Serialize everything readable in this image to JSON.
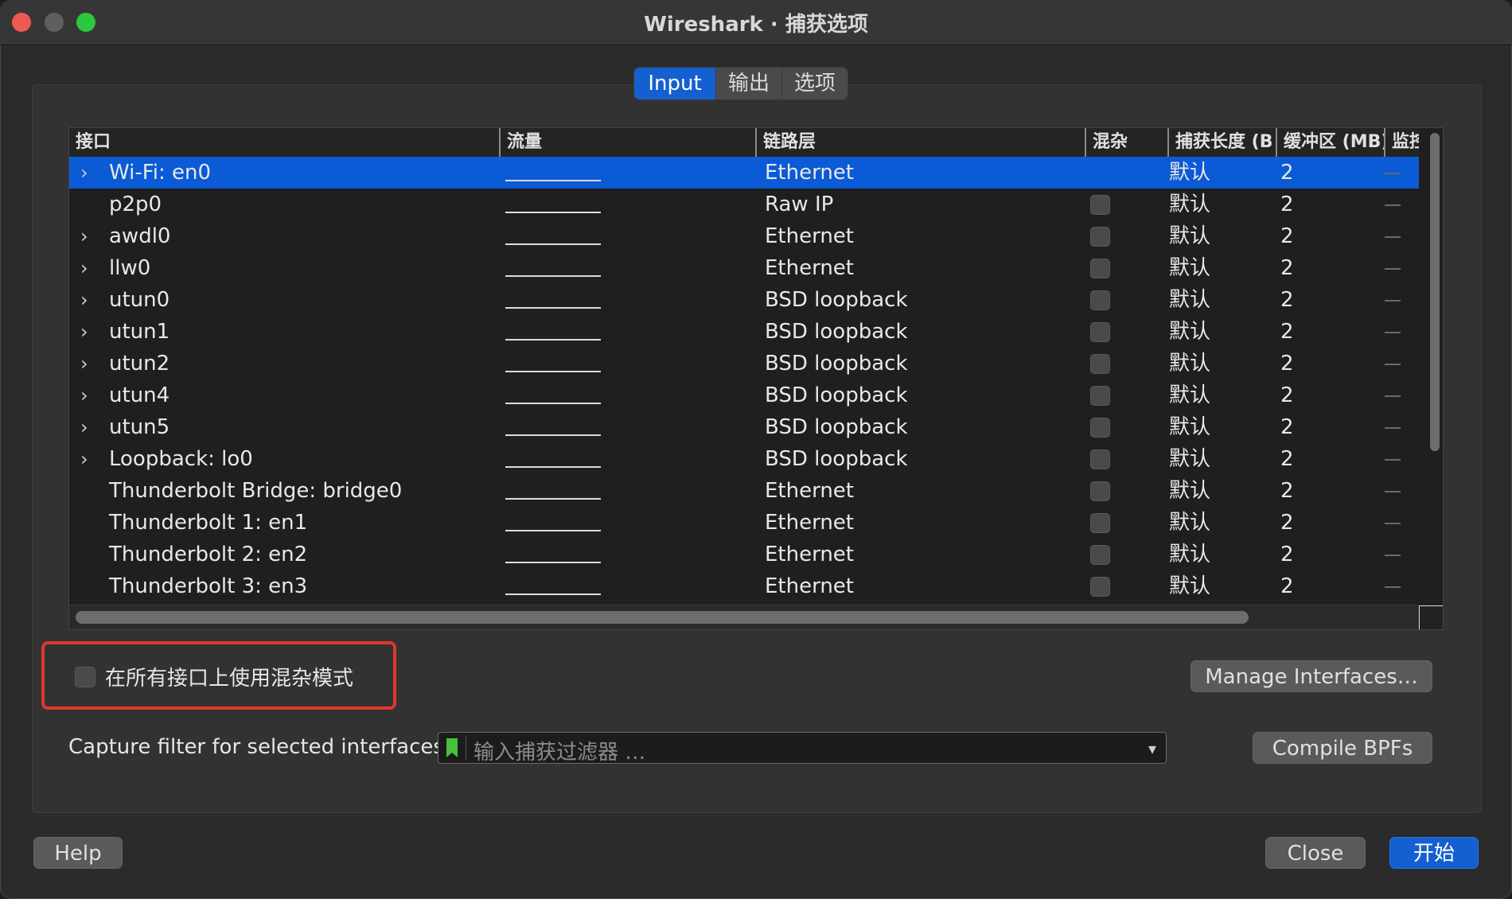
{
  "window": {
    "title": "Wireshark · 捕获选项"
  },
  "tabs": [
    {
      "label": "Input",
      "active": true
    },
    {
      "label": "输出",
      "active": false
    },
    {
      "label": "选项",
      "active": false
    }
  ],
  "table": {
    "columns": [
      "接口",
      "流量",
      "链路层",
      "混杂",
      "捕获长度 (B",
      "缓冲区 (MB)",
      "监控"
    ],
    "rows": [
      {
        "name": "Wi-Fi: en0",
        "expandable": true,
        "link": "Ethernet",
        "snaplen": "默认",
        "buffer": "2",
        "selected": true
      },
      {
        "name": "p2p0",
        "expandable": false,
        "link": "Raw IP",
        "snaplen": "默认",
        "buffer": "2"
      },
      {
        "name": "awdl0",
        "expandable": true,
        "link": "Ethernet",
        "snaplen": "默认",
        "buffer": "2"
      },
      {
        "name": "llw0",
        "expandable": true,
        "link": "Ethernet",
        "snaplen": "默认",
        "buffer": "2"
      },
      {
        "name": "utun0",
        "expandable": true,
        "link": "BSD loopback",
        "snaplen": "默认",
        "buffer": "2"
      },
      {
        "name": "utun1",
        "expandable": true,
        "link": "BSD loopback",
        "snaplen": "默认",
        "buffer": "2"
      },
      {
        "name": "utun2",
        "expandable": true,
        "link": "BSD loopback",
        "snaplen": "默认",
        "buffer": "2"
      },
      {
        "name": "utun4",
        "expandable": true,
        "link": "BSD loopback",
        "snaplen": "默认",
        "buffer": "2"
      },
      {
        "name": "utun5",
        "expandable": true,
        "link": "BSD loopback",
        "snaplen": "默认",
        "buffer": "2"
      },
      {
        "name": "Loopback: lo0",
        "expandable": true,
        "link": "BSD loopback",
        "snaplen": "默认",
        "buffer": "2"
      },
      {
        "name": "Thunderbolt Bridge: bridge0",
        "expandable": false,
        "link": "Ethernet",
        "snaplen": "默认",
        "buffer": "2"
      },
      {
        "name": "Thunderbolt 1: en1",
        "expandable": false,
        "link": "Ethernet",
        "snaplen": "默认",
        "buffer": "2"
      },
      {
        "name": "Thunderbolt 2: en2",
        "expandable": false,
        "link": "Ethernet",
        "snaplen": "默认",
        "buffer": "2"
      },
      {
        "name": "Thunderbolt 3: en3",
        "expandable": false,
        "link": "Ethernet",
        "snaplen": "默认",
        "buffer": "2"
      }
    ]
  },
  "promiscuous": {
    "label": "在所有接口上使用混杂模式",
    "checked": false
  },
  "buttons": {
    "manage": "Manage Interfaces…",
    "compile": "Compile BPFs",
    "help": "Help",
    "close": "Close",
    "start": "开始"
  },
  "filter": {
    "label": "Capture filter for selected interfaces:",
    "placeholder": "输入捕获过滤器 …"
  },
  "colors": {
    "accent": "#1460d0",
    "highlight": "#e3352b",
    "bookmark": "#46c13c"
  },
  "icons": {
    "expand": "chevron-right-icon",
    "dropdown": "chevron-down-icon",
    "bookmark": "bookmark-icon"
  }
}
